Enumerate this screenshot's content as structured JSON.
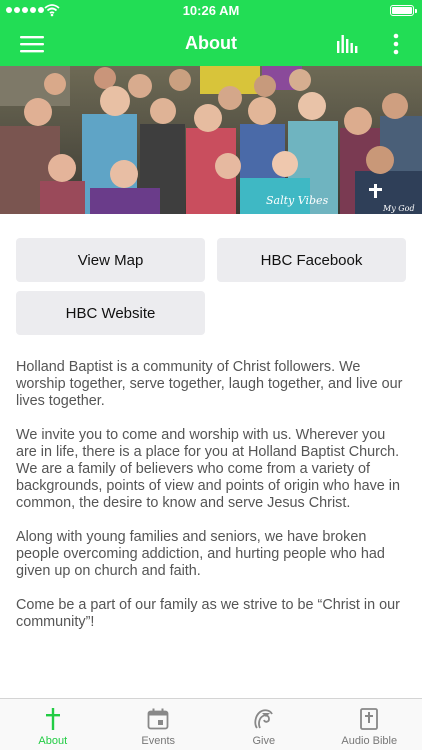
{
  "status_bar": {
    "time": "10:26 AM"
  },
  "nav": {
    "title": "About"
  },
  "hero": {
    "shirt_text_1": "Salty Vibes",
    "shirt_text_2": "My God"
  },
  "buttons": {
    "view_map": "View Map",
    "facebook": "HBC Facebook",
    "website": "HBC Website"
  },
  "content": {
    "paragraphs": [
      "Holland Baptist is a community of Christ followers. We worship together, serve together, laugh together, and live our lives together.",
      "We invite you to come and worship with us. Wherever you are in life, there is a place for you at Holland Baptist Church. We are a family of believers who come from a variety of backgrounds, points of view and points of origin who have in common, the desire to know and serve Jesus Christ.",
      "Along with young families and seniors, we have broken people overcoming addiction, and hurting people who had given up on church and faith.",
      "Come be a part of our family as we strive to be “Christ in our community”!"
    ]
  },
  "tabs": [
    {
      "label": "About",
      "icon": "cross-icon",
      "active": true
    },
    {
      "label": "Events",
      "icon": "calendar-icon",
      "active": false
    },
    {
      "label": "Give",
      "icon": "give-icon",
      "active": false
    },
    {
      "label": "Audio Bible",
      "icon": "bible-icon",
      "active": false
    }
  ],
  "colors": {
    "accent": "#22dd55",
    "active_tab": "#22cc44",
    "button_bg": "#ececef"
  }
}
